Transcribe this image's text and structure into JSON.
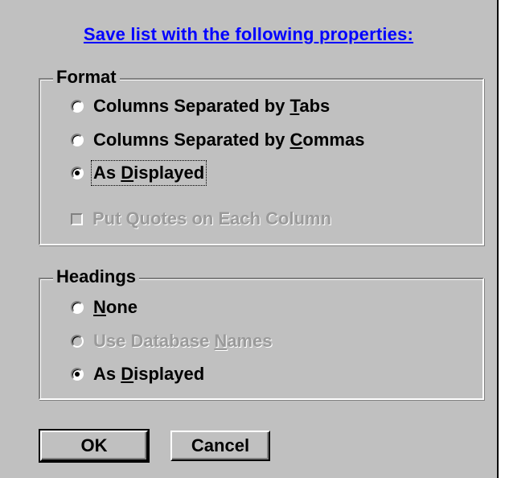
{
  "dialog": {
    "title": "Save list with the following properties:"
  },
  "format": {
    "legend": "Format",
    "options": [
      {
        "pre": "Columns Separated by ",
        "accel": "T",
        "post": "abs",
        "selected": false,
        "enabled": true
      },
      {
        "pre": "Columns Separated by ",
        "accel": "C",
        "post": "ommas",
        "selected": false,
        "enabled": true
      },
      {
        "pre": "As ",
        "accel": "D",
        "post": "isplayed",
        "selected": true,
        "enabled": true
      }
    ],
    "quotes_checkbox": {
      "label": "Put Quotes on Each Column",
      "checked": false,
      "enabled": false
    }
  },
  "headings": {
    "legend": "Headings",
    "options": [
      {
        "pre": "",
        "accel": "N",
        "post": "one",
        "selected": false,
        "enabled": true
      },
      {
        "pre": "Use Database ",
        "accel": "N",
        "post": "ames",
        "selected": false,
        "enabled": false
      },
      {
        "pre": "As ",
        "accel": "D",
        "post": "isplayed",
        "selected": true,
        "enabled": true
      }
    ]
  },
  "buttons": {
    "ok": "OK",
    "cancel": "Cancel"
  }
}
